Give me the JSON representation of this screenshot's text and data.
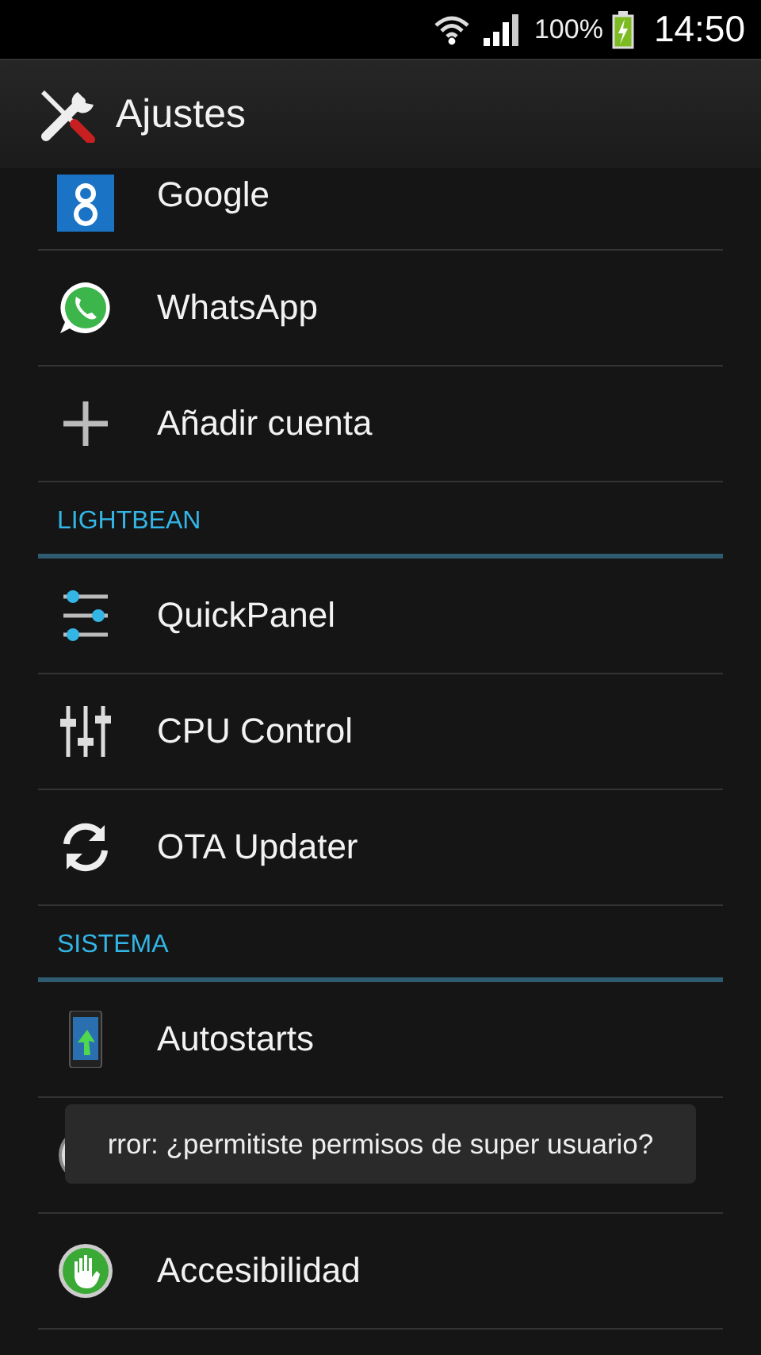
{
  "status_bar": {
    "battery": "100%",
    "time": "14:50"
  },
  "action_bar": {
    "title": "Ajustes"
  },
  "sections": [
    {
      "items": [
        {
          "kind": "google",
          "label": "Google"
        },
        {
          "kind": "whatsapp",
          "label": "WhatsApp"
        },
        {
          "kind": "add",
          "label": "Añadir cuenta"
        }
      ]
    },
    {
      "header": "LIGHTBEAN",
      "items": [
        {
          "kind": "sliders",
          "label": "QuickPanel"
        },
        {
          "kind": "equalizer",
          "label": "CPU Control"
        },
        {
          "kind": "sync",
          "label": "OTA Updater"
        }
      ]
    },
    {
      "header": "SISTEMA",
      "items": [
        {
          "kind": "phone",
          "label": "Autostarts"
        },
        {
          "kind": "covered"
        },
        {
          "kind": "accessibility",
          "label": "Accesibilidad"
        }
      ]
    }
  ],
  "toast": {
    "text": "rror: ¿permitiste permisos de super usuario?"
  }
}
